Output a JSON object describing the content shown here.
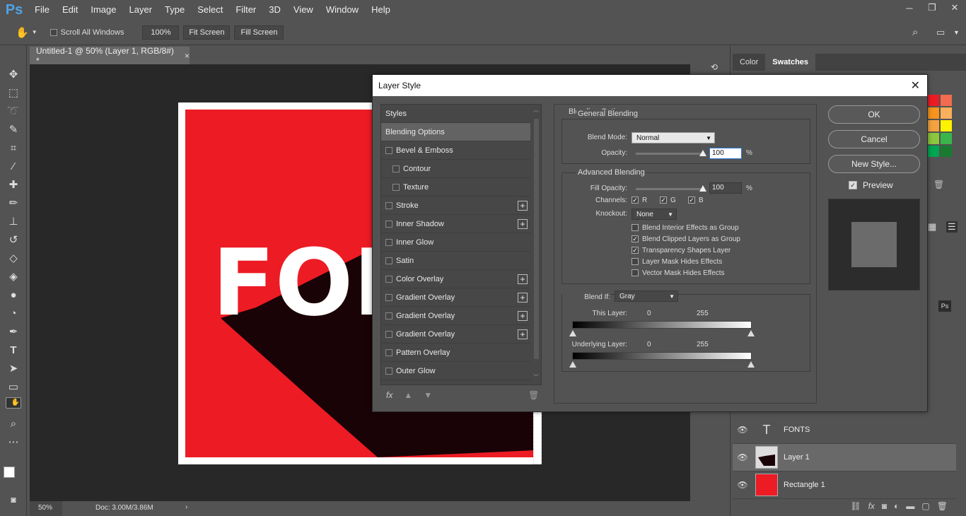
{
  "app": {
    "logo": "Ps",
    "menu": [
      "File",
      "Edit",
      "Image",
      "Layer",
      "Type",
      "Select",
      "Filter",
      "3D",
      "View",
      "Window",
      "Help"
    ],
    "window_controls": [
      "─",
      "❐",
      "✕"
    ]
  },
  "options": {
    "scroll_all_label": "Scroll All Windows",
    "zoom_value": "100%",
    "fit_screen": "Fit Screen",
    "fill_screen": "Fill Screen"
  },
  "document": {
    "tab_title": "Untitled-1 @ 50% (Layer 1, RGB/8#) *",
    "close": "×",
    "artwork_text": "FON",
    "zoom": "50%",
    "doc_info": "Doc: 3.00M/3.86M",
    "colors": {
      "red": "#ed1b24",
      "shadow": "#1a0306",
      "white": "#ffffff"
    }
  },
  "right": {
    "tabs": [
      "Color",
      "Swatches"
    ],
    "active_tab": "Swatches",
    "ps_badge": "Ps",
    "swatch_colors": [
      "#ed1c24",
      "#f26c4f",
      "#f7941d",
      "#fbaf5d",
      "#f5a340",
      "#fff200",
      "#8dc63f",
      "#39b54a",
      "#00a651",
      "#197b30"
    ]
  },
  "layers": [
    {
      "name": "FONTS",
      "type": "T"
    },
    {
      "name": "Layer 1",
      "type": "pixel",
      "selected": true
    },
    {
      "name": "Rectangle 1",
      "type": "shape"
    }
  ],
  "dialog": {
    "title": "Layer Style",
    "styles_header": "Styles",
    "styles": [
      {
        "label": "Blending Options",
        "checkbox": false,
        "active": true
      },
      {
        "label": "Bevel & Emboss",
        "checkbox": true
      },
      {
        "label": "Contour",
        "checkbox": true,
        "indent": true
      },
      {
        "label": "Texture",
        "checkbox": true,
        "indent": true
      },
      {
        "label": "Stroke",
        "checkbox": true,
        "plus": true
      },
      {
        "label": "Inner Shadow",
        "checkbox": true,
        "plus": true
      },
      {
        "label": "Inner Glow",
        "checkbox": true
      },
      {
        "label": "Satin",
        "checkbox": true
      },
      {
        "label": "Color Overlay",
        "checkbox": true,
        "plus": true
      },
      {
        "label": "Gradient Overlay",
        "checkbox": true,
        "plus": true
      },
      {
        "label": "Gradient Overlay",
        "checkbox": true,
        "plus": true
      },
      {
        "label": "Gradient Overlay",
        "checkbox": true,
        "plus": true
      },
      {
        "label": "Pattern Overlay",
        "checkbox": true
      },
      {
        "label": "Outer Glow",
        "checkbox": true
      }
    ],
    "footer_icons": [
      "fx",
      "▲",
      "▼",
      "🗑"
    ],
    "blending": {
      "section": "Blending Options",
      "general": "General Blending",
      "blend_mode_label": "Blend Mode:",
      "blend_mode": "Normal",
      "opacity_label": "Opacity:",
      "opacity": "100",
      "pct": "%",
      "advanced": "Advanced Blending",
      "fill_label": "Fill Opacity:",
      "fill": "100",
      "channels_label": "Channels:",
      "ch_r": "R",
      "ch_g": "G",
      "ch_b": "B",
      "knockout_label": "Knockout:",
      "knockout": "None",
      "opts": [
        {
          "label": "Blend Interior Effects as Group",
          "checked": false
        },
        {
          "label": "Blend Clipped Layers as Group",
          "checked": true
        },
        {
          "label": "Transparency Shapes Layer",
          "checked": true
        },
        {
          "label": "Layer Mask Hides Effects",
          "checked": false
        },
        {
          "label": "Vector Mask Hides Effects",
          "checked": false
        }
      ],
      "blendif_label": "Blend If:",
      "blendif": "Gray",
      "this_layer": "This Layer:",
      "under_layer": "Underlying Layer:",
      "min": "0",
      "max": "255"
    },
    "buttons": {
      "ok": "OK",
      "cancel": "Cancel",
      "new_style": "New Style...",
      "preview": "Preview"
    }
  }
}
